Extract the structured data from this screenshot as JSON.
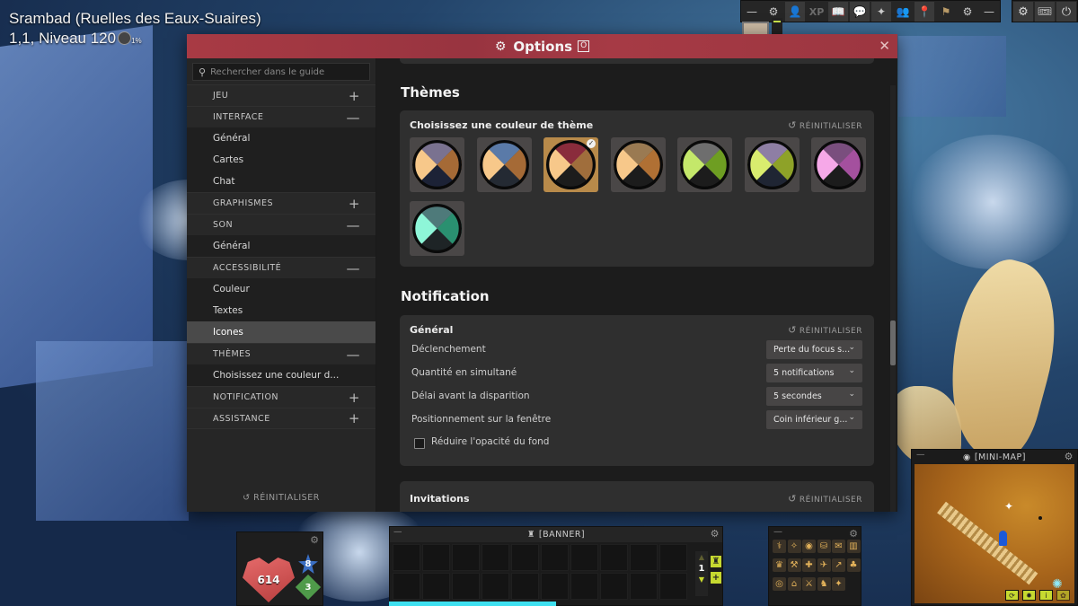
{
  "location": {
    "zone": "Srambad (Ruelles des Eaux-Suaires)",
    "coords_level": "1,1, Niveau 120",
    "xp_percent": "1%"
  },
  "top_toolbar": {
    "items": [
      {
        "name": "minimize",
        "glyph": "—"
      },
      {
        "name": "settings",
        "glyph": "⚙"
      },
      {
        "name": "character",
        "glyph": "👤"
      },
      {
        "name": "xp",
        "glyph": "XP"
      },
      {
        "name": "guide-book",
        "glyph": "📖"
      },
      {
        "name": "chat",
        "glyph": "💬"
      },
      {
        "name": "companion",
        "glyph": "✦"
      },
      {
        "name": "group",
        "glyph": "👥"
      },
      {
        "name": "map-pin",
        "glyph": "📍"
      },
      {
        "name": "guild",
        "glyph": "⚑"
      },
      {
        "name": "settings-2",
        "glyph": "⚙"
      },
      {
        "name": "minimize-2",
        "glyph": "—"
      }
    ],
    "system_items": [
      {
        "name": "options",
        "glyph": "⚙"
      },
      {
        "name": "ticket",
        "glyph": "🎟"
      },
      {
        "name": "power",
        "glyph": "⏻"
      }
    ]
  },
  "window": {
    "title": "Options",
    "shortcut_key": "O",
    "close_glyph": "✕"
  },
  "sidebar": {
    "search_placeholder": "Rechercher dans le guide",
    "reset_label": "RÉINITIALISER",
    "sections": [
      {
        "label": "JEU",
        "toggle": "+",
        "items": []
      },
      {
        "label": "INTERFACE",
        "toggle": "—",
        "items": [
          "Général",
          "Cartes",
          "Chat"
        ]
      },
      {
        "label": "GRAPHISMES",
        "toggle": "+",
        "items": []
      },
      {
        "label": "SON",
        "toggle": "—",
        "items": [
          "Général"
        ]
      },
      {
        "label": "ACCESSIBILITÉ",
        "toggle": "—",
        "items": [
          "Couleur",
          "Textes",
          "Icones"
        ]
      },
      {
        "label": "THÈMES",
        "toggle": "—",
        "items": [
          "Choisissez une couleur d..."
        ]
      },
      {
        "label": "NOTIFICATION",
        "toggle": "+",
        "items": []
      },
      {
        "label": "ASSISTANCE",
        "toggle": "+",
        "items": []
      }
    ],
    "active_item": "Icones"
  },
  "themes": {
    "heading": "Thèmes",
    "card_title": "Choisissez une couleur de thème",
    "reset_label": "RÉINITIALISER",
    "selected_index": 2,
    "swatches": [
      {
        "top": "#7a7290",
        "left": "#f7c88a",
        "right": "#a56a36",
        "bottom": "#1c2236"
      },
      {
        "top": "#5a7aa8",
        "left": "#f7c88a",
        "right": "#a56a36",
        "bottom": "#242a33"
      },
      {
        "top": "#8a2c3c",
        "left": "#f7c88a",
        "right": "#a06e3c",
        "bottom": "#1c1c1c"
      },
      {
        "top": "#9a7a52",
        "left": "#f7c88a",
        "right": "#b07034",
        "bottom": "#1c1c1c"
      },
      {
        "top": "#6e6e6e",
        "left": "#c4e86a",
        "right": "#6e9e22",
        "bottom": "#1c1c1c"
      },
      {
        "top": "#8e7ea4",
        "left": "#d9ec6e",
        "right": "#8ea228",
        "bottom": "#1f2533"
      },
      {
        "top": "#7a4e7e",
        "left": "#f6a8e8",
        "right": "#a4509e",
        "bottom": "#1c1c1c"
      },
      {
        "top": "#4e7a7a",
        "left": "#8ef6d8",
        "right": "#2a9070",
        "bottom": "#1e2426"
      }
    ]
  },
  "notification": {
    "heading": "Notification",
    "general": {
      "title": "Général",
      "reset_label": "RÉINITIALISER",
      "rows": [
        {
          "label": "Déclenchement",
          "value": "Perte du focus s..."
        },
        {
          "label": "Quantité en simultané",
          "value": "5 notifications"
        },
        {
          "label": "Délai avant la disparition",
          "value": "5 secondes"
        },
        {
          "label": "Positionnement sur la fenêtre",
          "value": "Coin inférieur g..."
        }
      ],
      "checkbox_label": "Réduire l'opacité du fond",
      "checkbox_checked": false
    },
    "invitations": {
      "title": "Invitations",
      "reset_label": "RÉINITIALISER"
    }
  },
  "hud": {
    "health": "614",
    "action_points": "8",
    "movement_points": "3",
    "banner": {
      "title": "[BANNER]",
      "page": "1"
    },
    "minimap": {
      "title": "[MINI-MAP]"
    }
  }
}
